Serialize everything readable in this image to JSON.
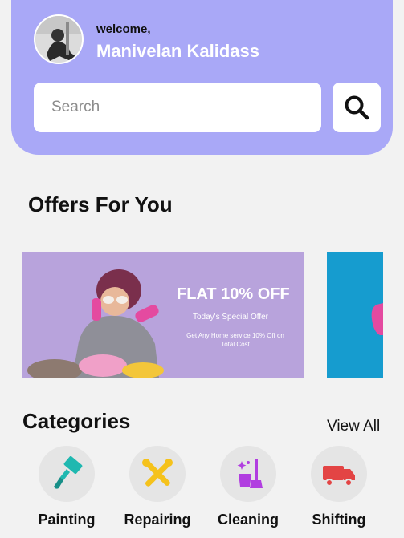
{
  "header": {
    "welcome": "welcome,",
    "username": "Manivelan Kalidass",
    "search_placeholder": "Search",
    "bg_color": "#a9a8f7"
  },
  "offers": {
    "title": "Offers For You",
    "banner": {
      "headline": "FLAT 10% OFF",
      "subtitle": "Today's Special Offer",
      "description": "Get Any Home service 10% Off on Total Cost"
    }
  },
  "categories": {
    "title": "Categories",
    "view_all": "View All",
    "items": [
      {
        "label": "Painting",
        "icon": "paint-roller-icon",
        "color": "#1fb8b0"
      },
      {
        "label": "Repairing",
        "icon": "tools-icon",
        "color": "#f5c21b"
      },
      {
        "label": "Cleaning",
        "icon": "cleaning-icon",
        "color": "#b13ee0"
      },
      {
        "label": "Shifting",
        "icon": "truck-icon",
        "color": "#e34444"
      }
    ]
  }
}
